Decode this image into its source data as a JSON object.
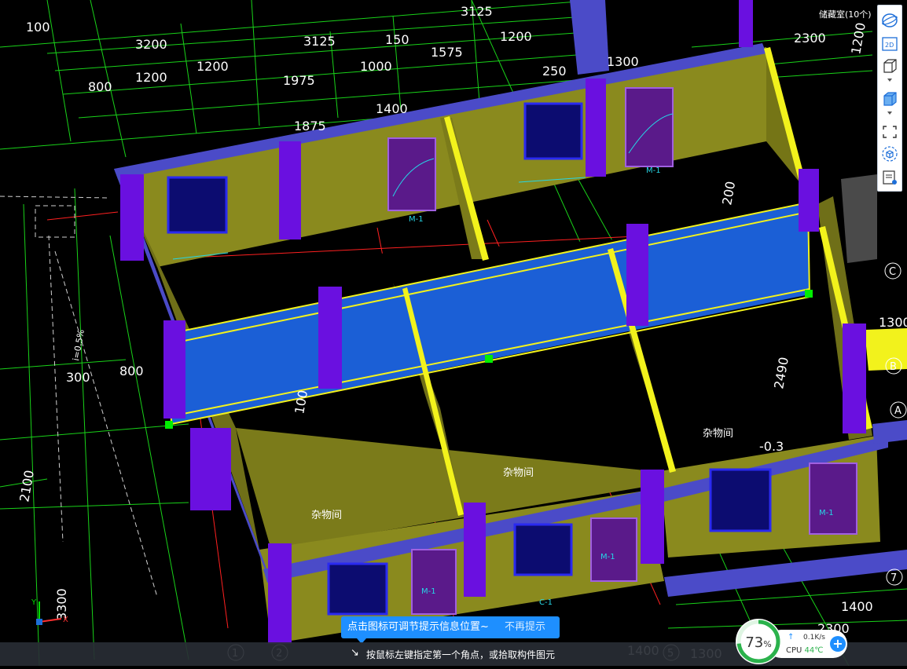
{
  "drawing": {
    "dims_top": [
      "3125",
      "100",
      "3200",
      "3125",
      "150",
      "1200",
      "800",
      "1200",
      "1200",
      "1975",
      "1000",
      "1575",
      "250",
      "1400",
      "1875",
      "1300",
      "2300",
      "1200"
    ],
    "dims_left": [
      "300",
      "800",
      "2100",
      "3300",
      "i=0.5%"
    ],
    "dims_mid": [
      "200",
      "100",
      "2490",
      "-0.3"
    ],
    "dims_right": [
      "1300",
      "1400",
      "2300",
      "1300",
      "1400"
    ],
    "room_labels": [
      "杂物间",
      "杂物间",
      "杂物间"
    ],
    "door_tags": [
      "M-1",
      "M-1",
      "M-1",
      "M-1",
      "M-1",
      "C-1"
    ],
    "grid_bubbles": [
      "1",
      "2",
      "5",
      "7",
      "A",
      "B",
      "C"
    ],
    "corner_note": "储藏室(10个)"
  },
  "toolbar": {
    "items": [
      {
        "name": "perspective-view",
        "icon": "orbit-icon"
      },
      {
        "name": "2d-view",
        "label": "2D",
        "icon": "2d-icon"
      },
      {
        "name": "box-view",
        "icon": "box-outline-icon"
      },
      {
        "name": "solid-view",
        "icon": "box-solid-icon"
      },
      {
        "name": "fit-view",
        "icon": "fullscreen-icon"
      },
      {
        "name": "3d-rotate",
        "icon": "cube-rotate-icon"
      },
      {
        "name": "display-settings",
        "icon": "list-eye-icon"
      }
    ],
    "colors": {
      "accent": "#1e6fd9"
    }
  },
  "tip": {
    "message": "点击图标可调节提示信息位置~",
    "dismiss": "不再提示"
  },
  "status": {
    "prompt": "按鼠标左键指定第一个角点，或拾取构件图元"
  },
  "perf": {
    "percent": "73",
    "percent_unit": "%",
    "net_speed": "0.1K/s",
    "cpu_label": "CPU",
    "cpu_temp": "44℃"
  },
  "axis": {
    "x": "X",
    "y": "Y"
  },
  "colors": {
    "background": "#000000",
    "wall": "#8a8a1e",
    "column": "#6a10e0",
    "beam_top": "#4b4bc8",
    "selected_wall": "#1b5fd6",
    "highlight": "#f2f21c",
    "grid_green": "#19d219",
    "grid_red": "#ff2020",
    "tip_bg": "#1e8fff"
  }
}
